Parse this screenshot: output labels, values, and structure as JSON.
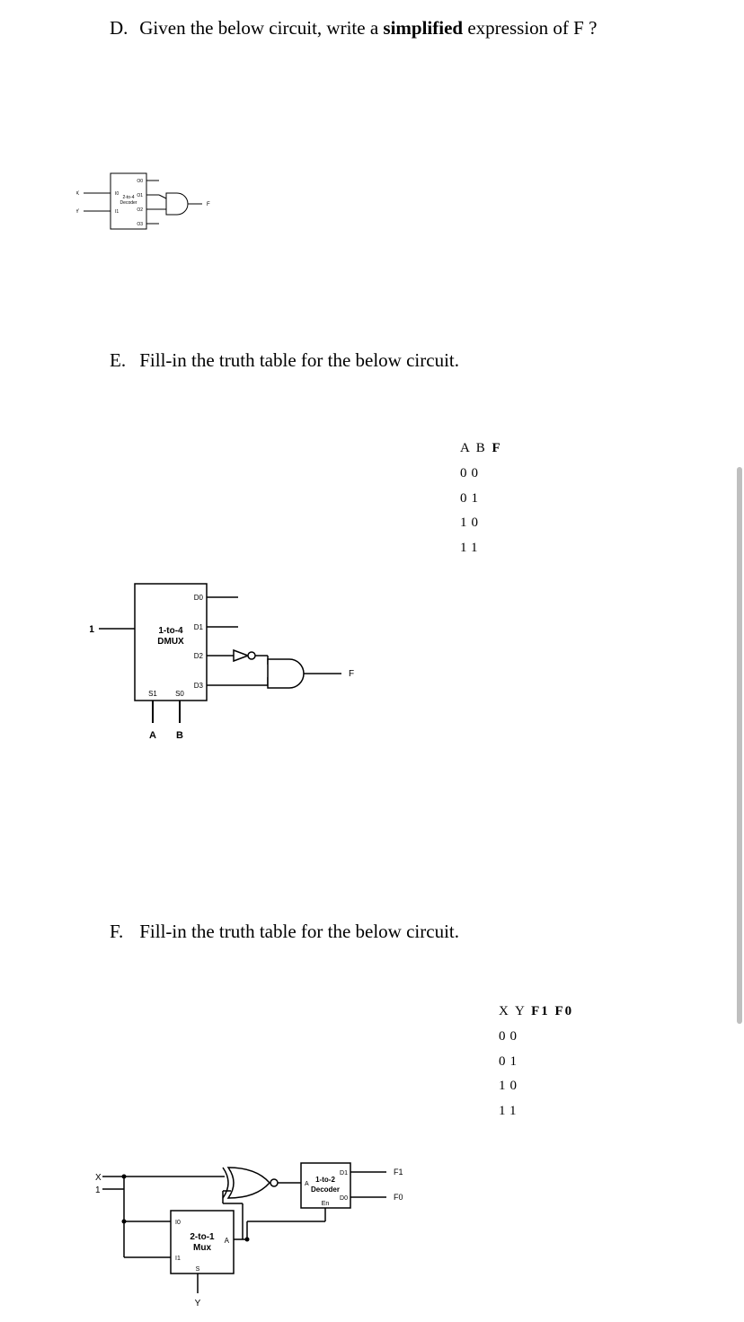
{
  "questionD": {
    "label": "D.",
    "text": "Given the below circuit, write a simplified expression of F ?"
  },
  "questionE": {
    "label": "E.",
    "text": "Fill-in the truth table for the below circuit."
  },
  "questionF": {
    "label": "F.",
    "text": "Fill-in the truth table for the below circuit."
  },
  "figD": {
    "x": "X",
    "y": "Y",
    "i0": "I0",
    "i1": "I1",
    "name_l1": "2-to-4",
    "name_l2": "Decoder",
    "o0": "O0",
    "o1": "O1",
    "o2": "O2",
    "o3": "O3",
    "f": "F"
  },
  "figE": {
    "in": "1",
    "name_l1": "1-to-4",
    "name_l2": "DMUX",
    "d0": "D0",
    "d1": "D1",
    "d2": "D2",
    "d3": "D3",
    "s1": "S1",
    "s0": "S0",
    "a": "A",
    "b": "B",
    "f": "F"
  },
  "tableE": {
    "header": [
      "A",
      "B",
      "F"
    ],
    "rows": [
      [
        "0",
        "0"
      ],
      [
        "0",
        "1"
      ],
      [
        "1",
        "0"
      ],
      [
        "1",
        "1"
      ]
    ]
  },
  "figF": {
    "x": "X",
    "one": "1",
    "mux_l1": "2-to-1",
    "mux_l2": "Mux",
    "mux_i0": "I0",
    "mux_i1": "I1",
    "mux_s": "S",
    "mux_a": "A",
    "y": "Y",
    "dec_l1": "1-to-2",
    "dec_l2": "Decoder",
    "dec_a": "A",
    "dec_en": "En",
    "dec_d1": "D1",
    "dec_d0": "D0",
    "f1": "F1",
    "f0": "F0"
  },
  "tableF": {
    "header": [
      "X",
      "Y",
      "F1",
      "F0"
    ],
    "rows": [
      [
        "0",
        "0"
      ],
      [
        "0",
        "1"
      ],
      [
        "1",
        "0"
      ],
      [
        "1",
        "1"
      ]
    ]
  }
}
